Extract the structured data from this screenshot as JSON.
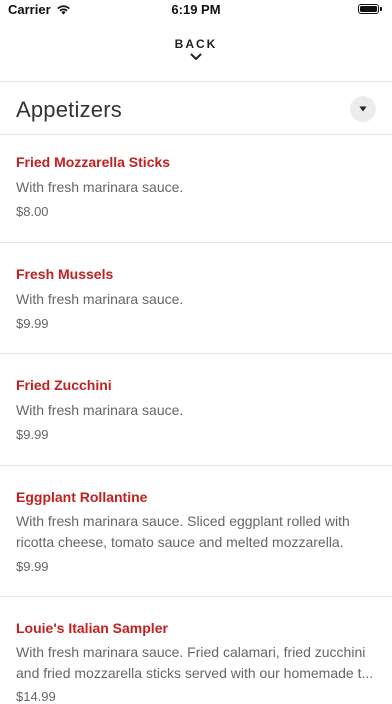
{
  "status_bar": {
    "carrier": "Carrier",
    "time": "6:19 PM"
  },
  "nav": {
    "back_label": "BACK"
  },
  "section": {
    "title": "Appetizers"
  },
  "items": [
    {
      "name": "Fried Mozzarella Sticks",
      "description": "With fresh marinara sauce.",
      "price": "$8.00"
    },
    {
      "name": "Fresh Mussels",
      "description": "With fresh marinara sauce.",
      "price": "$9.99"
    },
    {
      "name": "Fried Zucchini",
      "description": "With fresh marinara sauce.",
      "price": "$9.99"
    },
    {
      "name": "Eggplant Rollantine",
      "description_line1": "With fresh marinara sauce. Sliced eggplant rolled with",
      "description_line2": "ricotta cheese, tomato sauce and melted mozzarella.",
      "price": "$9.99"
    },
    {
      "name": "Louie's Italian Sampler",
      "description_line1": "With fresh marinara sauce. Fried calamari, fried zucchini",
      "description_line2": "and fried mozzarella sticks served with our homemade t...",
      "price": "$14.99"
    }
  ],
  "colors": {
    "item_name": "#c41f1f",
    "text_secondary": "#666666",
    "divider": "#e6e6e6"
  }
}
